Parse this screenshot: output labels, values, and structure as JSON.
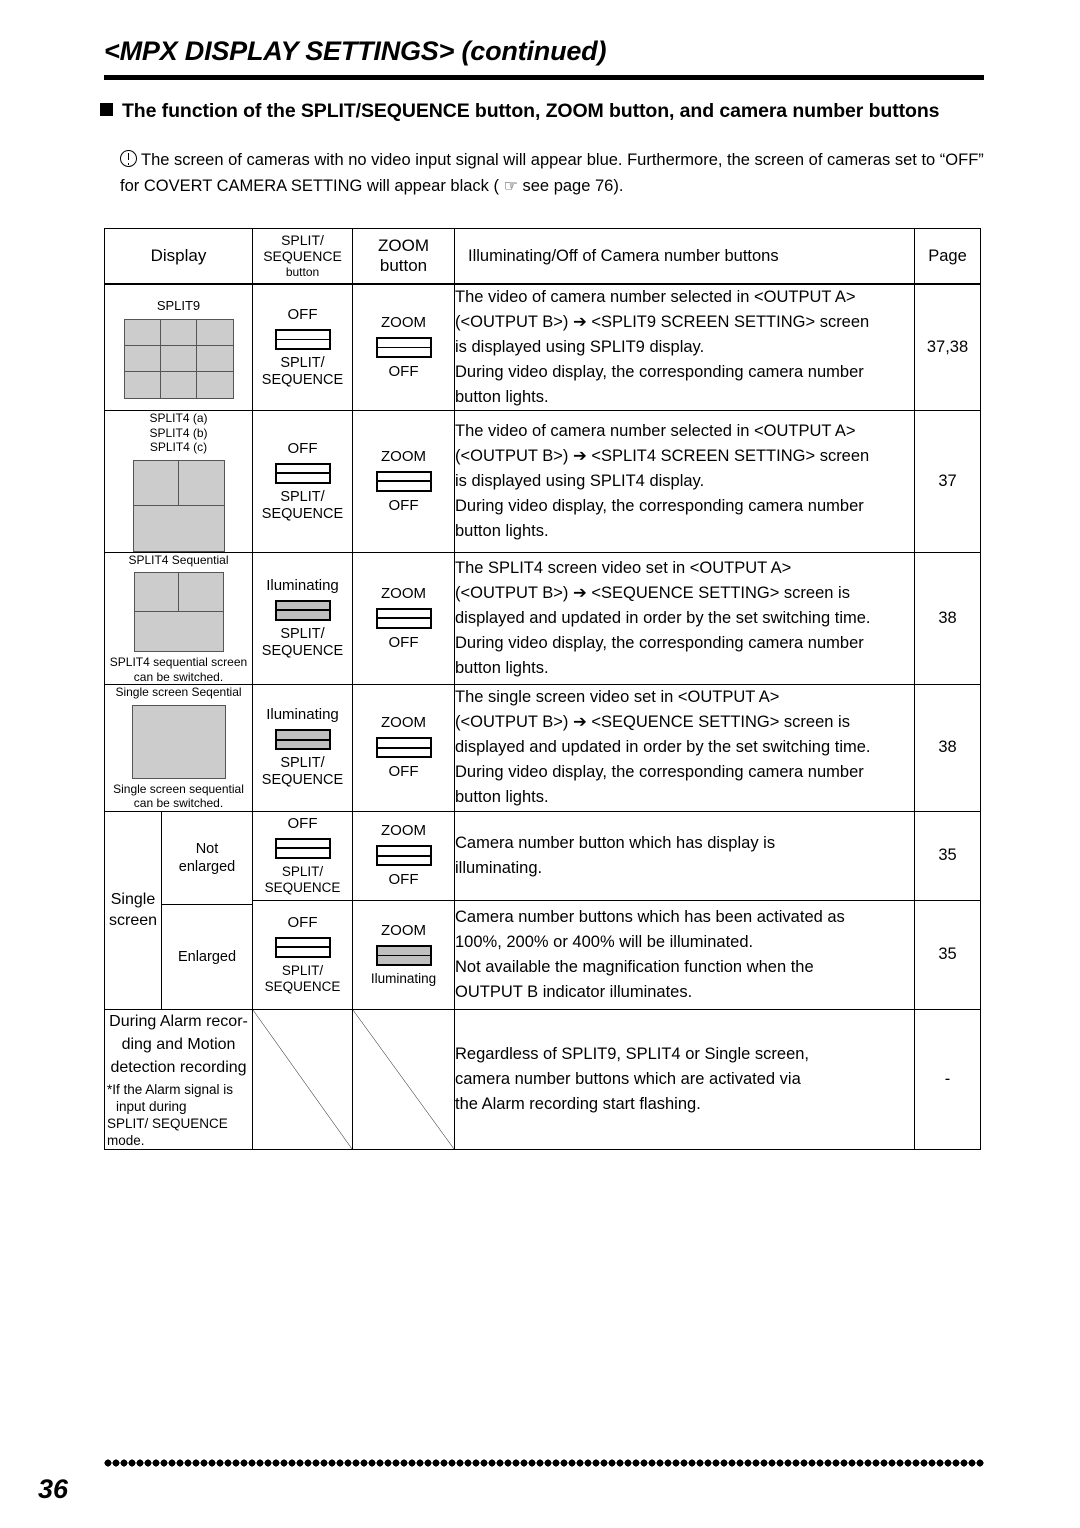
{
  "header": {
    "chapter_title": "<MPX DISPLAY SETTINGS> (continued)",
    "section_heading": "The function of the SPLIT/SEQUENCE button, ZOOM button, and camera number buttons",
    "bullet_icon": "filled-square-icon"
  },
  "note": {
    "icon": "exclamation-circle-icon",
    "hand_icon": "☞",
    "text_before": "The screen of cameras with no video input signal will appear blue. Furthermore, the screen of cameras set to “OFF” for COVERT CAMERA SETTING will appear black ( ",
    "text_after": " see page 76)."
  },
  "table": {
    "headers": {
      "display": "Display",
      "split_line1": "SPLIT/",
      "split_line2": "SEQUENCE",
      "split_line3": "button",
      "zoom_line1": "ZOOM",
      "zoom_line2": "button",
      "description": "Illuminating/Off of Camera number buttons",
      "page": "Page"
    },
    "rows": [
      {
        "id": "split9",
        "display_labels": [
          "SPLIT9"
        ],
        "display_icon": "split9-grid-icon",
        "display_note": "",
        "split_top": "OFF",
        "split_state": "off",
        "split_bottom_line1": "SPLIT/",
        "split_bottom_line2": "SEQUENCE",
        "zoom_top": "ZOOM",
        "zoom_state": "off",
        "zoom_bottom": "OFF",
        "description_lines": [
          "The video of camera number selected in <OUTPUT A>",
          "(<OUTPUT B>) ➔ <SPLIT9 SCREEN SETTING> screen",
          "is displayed using SPLIT9 display.",
          "During video display, the corresponding camera number",
          "button lights."
        ],
        "page": "37,38"
      },
      {
        "id": "split4",
        "display_labels": [
          "SPLIT4 (a)",
          "SPLIT4 (b)",
          "SPLIT4 (c)"
        ],
        "display_icon": "split4-grid-icon",
        "display_note": "",
        "split_top": "OFF",
        "split_state": "off",
        "split_bottom_line1": "SPLIT/",
        "split_bottom_line2": "SEQUENCE",
        "zoom_top": "ZOOM",
        "zoom_state": "off",
        "zoom_bottom": "OFF",
        "description_lines": [
          "The video of camera number selected in <OUTPUT A>",
          "(<OUTPUT B>) ➔ <SPLIT4 SCREEN SETTING> screen",
          "is displayed using SPLIT4 display.",
          "During video display, the corresponding camera number",
          "button lights."
        ],
        "page": "37"
      },
      {
        "id": "split4-sequential",
        "display_labels": [
          "SPLIT4 Sequential"
        ],
        "display_icon": "split4-grid-icon",
        "display_note": "SPLIT4 sequential screen can be switched.",
        "split_top": "Iluminating",
        "split_state": "lit",
        "split_bottom_line1": "SPLIT/",
        "split_bottom_line2": "SEQUENCE",
        "zoom_top": "ZOOM",
        "zoom_state": "off",
        "zoom_bottom": "OFF",
        "description_lines": [
          "The SPLIT4 screen video set in <OUTPUT A>",
          "(<OUTPUT B>) ➔ <SEQUENCE SETTING> screen is",
          "displayed and updated in order by the set switching time.",
          "During video display, the corresponding camera number",
          "button lights."
        ],
        "page": "38"
      },
      {
        "id": "single-screen-sequential",
        "display_labels": [
          "Single screen Seqential"
        ],
        "display_icon": "single-screen-icon",
        "display_note": "Single screen sequential can be switched.",
        "split_top": "Iluminating",
        "split_state": "lit",
        "split_bottom_line1": "SPLIT/",
        "split_bottom_line2": "SEQUENCE",
        "zoom_top": "ZOOM",
        "zoom_state": "off",
        "zoom_bottom": "OFF",
        "description_lines": [
          "The single screen video set in <OUTPUT A>",
          "(<OUTPUT B>) ➔ <SEQUENCE SETTING> screen is",
          "displayed and updated in order by the set switching time.",
          "During video display, the corresponding camera number",
          "button lights."
        ],
        "page": "38"
      }
    ],
    "single_screen": {
      "label_line1": "Single",
      "label_line2": "screen",
      "sub_rows": [
        {
          "id": "not-enlarged",
          "sub_label_line1": "Not",
          "sub_label_line2": "enlarged",
          "split_top": "OFF",
          "split_state": "off",
          "split_bottom_line1": "SPLIT/",
          "split_bottom_line2": "SEQUENCE",
          "zoom_top": "ZOOM",
          "zoom_state": "off",
          "zoom_bottom": "OFF",
          "description_lines": [
            "Camera number button which has display is",
            "illuminating."
          ],
          "page": "35"
        },
        {
          "id": "enlarged",
          "sub_label_line1": "Enlarged",
          "sub_label_line2": "",
          "split_top": "OFF",
          "split_state": "off",
          "split_bottom_line1": "SPLIT/",
          "split_bottom_line2": "SEQUENCE",
          "zoom_top": "ZOOM",
          "zoom_state": "lit",
          "zoom_bottom": "Iluminating",
          "description_lines": [
            "Camera number buttons which has been activated as",
            "100%, 200% or 400% will be illuminated.",
            "Not available the magnification function when the",
            "OUTPUT  B indicator illuminates."
          ],
          "page": "35"
        }
      ]
    },
    "alarm_row": {
      "id": "alarm-recording",
      "main_lines": [
        "During Alarm recor-",
        "ding and Motion",
        "detection recording"
      ],
      "sub_lines": [
        "*If the Alarm signal is",
        "input during",
        "SPLIT/ SEQUENCE",
        "mode."
      ],
      "split_cell": "diagonal-strike",
      "zoom_cell": "diagonal-strike",
      "description_lines": [
        "Regardless of SPLIT9, SPLIT4 or Single screen,",
        "camera number buttons which are activated via",
        "the Alarm recording start flashing."
      ],
      "page": "-"
    }
  },
  "footer": {
    "page_number": "36"
  }
}
